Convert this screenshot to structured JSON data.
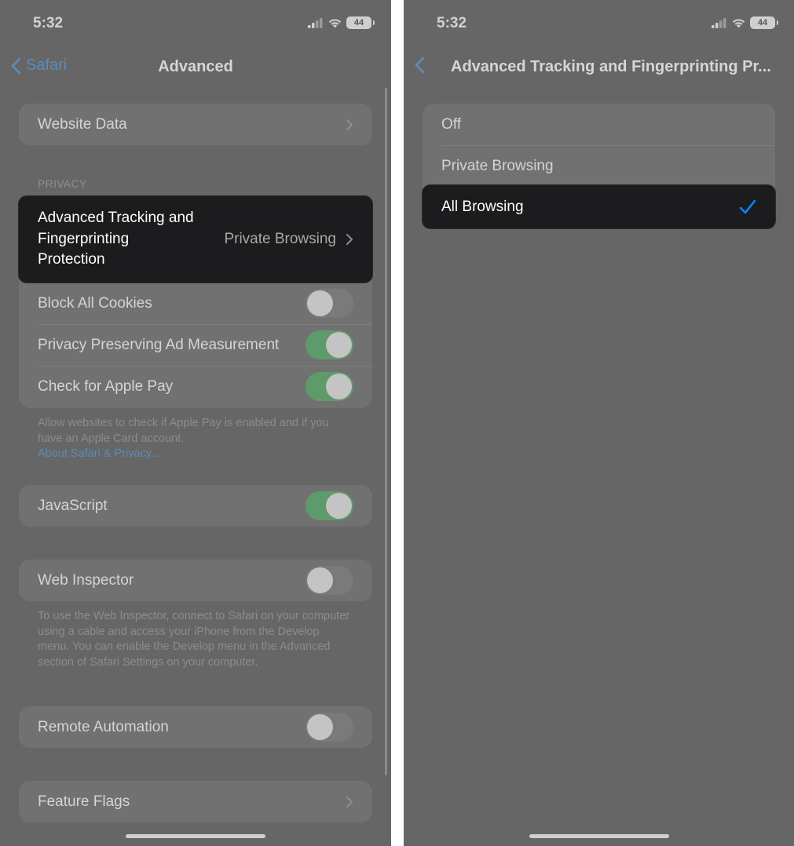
{
  "status_bar": {
    "time": "5:32",
    "battery": "44"
  },
  "left": {
    "nav": {
      "back_label": "Safari",
      "title": "Advanced"
    },
    "website_data": {
      "label": "Website Data"
    },
    "privacy_header": "PRIVACY",
    "tracking": {
      "label_lines": [
        "Advanced Tracking and",
        "Fingerprinting",
        "Protection"
      ],
      "value": "Private Browsing"
    },
    "privacy_rows": [
      {
        "label": "Block All Cookies",
        "state": "off"
      },
      {
        "label": "Privacy Preserving Ad Measurement",
        "state": "on"
      },
      {
        "label": "Check for Apple Pay",
        "state": "on"
      }
    ],
    "apple_pay_note": "Allow websites to check if Apple Pay is enabled and if you have an Apple Card account.",
    "privacy_link": "About Safari & Privacy...",
    "javascript": {
      "label": "JavaScript",
      "state": "on"
    },
    "web_inspector": {
      "label": "Web Inspector",
      "state": "off"
    },
    "web_inspector_note": "To use the Web Inspector, connect to Safari on your computer using a cable and access your iPhone from the Develop menu. You can enable the Develop menu in the Advanced section of Safari Settings on your computer.",
    "remote_automation": {
      "label": "Remote Automation",
      "state": "off"
    },
    "feature_flags": {
      "label": "Feature Flags"
    }
  },
  "right": {
    "nav": {
      "title": "Advanced Tracking and Fingerprinting Pr..."
    },
    "options": [
      {
        "label": "Off",
        "selected": false
      },
      {
        "label": "Private Browsing",
        "selected": false
      },
      {
        "label": "All Browsing",
        "selected": true
      }
    ]
  },
  "colors": {
    "accent": "#0a84ff",
    "toggle_on": "#5f9a6a",
    "link": "#5b8bb7"
  }
}
